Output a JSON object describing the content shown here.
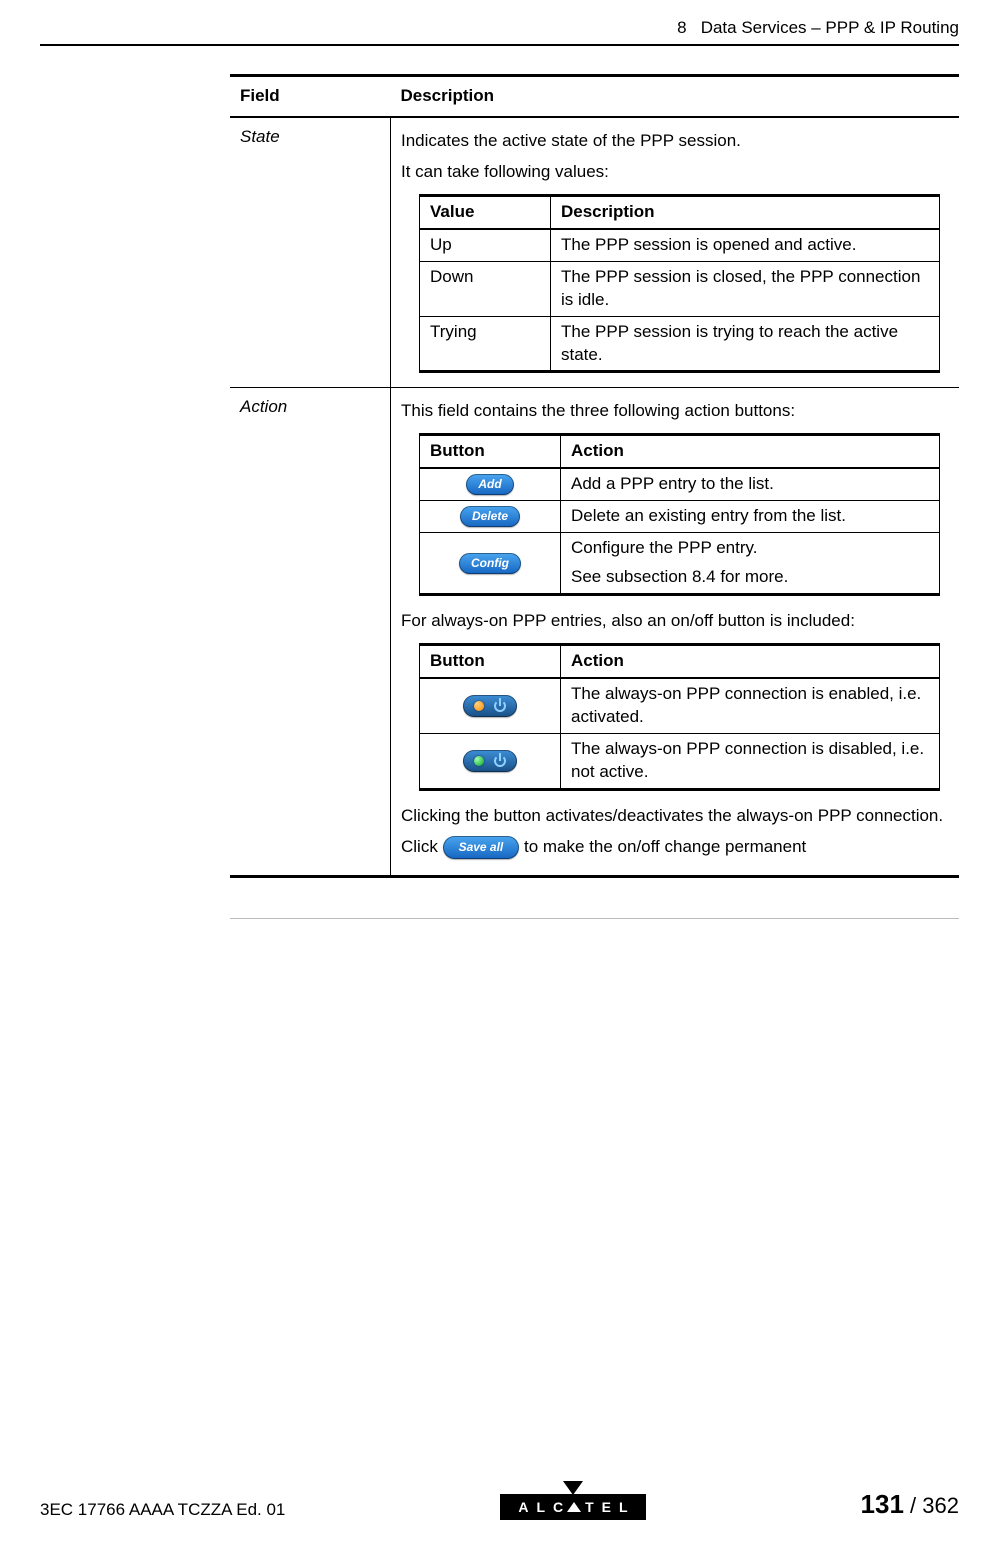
{
  "header": {
    "chapter_num": "8",
    "chapter_title": "Data Services – PPP & IP Routing"
  },
  "main_table": {
    "headers": {
      "field": "Field",
      "description": "Description"
    },
    "rows": {
      "state": {
        "field": "State",
        "p1": "Indicates the active state of the PPP session.",
        "p2": "It can take following values:",
        "values_table": {
          "headers": {
            "value": "Value",
            "description": "Description"
          },
          "rows": [
            {
              "value": "Up",
              "desc": "The PPP session is opened and active."
            },
            {
              "value": "Down",
              "desc": "The PPP session is closed, the PPP connection is idle."
            },
            {
              "value": "Trying",
              "desc": "The PPP session is trying to reach the active state."
            }
          ]
        }
      },
      "action": {
        "field": "Action",
        "p1": "This field contains the three following action buttons:",
        "buttons_table": {
          "headers": {
            "button": "Button",
            "action": "Action"
          },
          "rows": [
            {
              "btn": "Add",
              "desc": "Add a PPP entry to the list."
            },
            {
              "btn": "Delete",
              "desc": "Delete an existing entry from the list."
            },
            {
              "btn": "Config",
              "desc1": "Configure the PPP entry.",
              "desc2": "See subsection 8.4 for more."
            }
          ]
        },
        "p2": "For always-on PPP entries, also an on/off button is included:",
        "onoff_table": {
          "headers": {
            "button": "Button",
            "action": "Action"
          },
          "rows": [
            {
              "state": "on",
              "desc": "The always-on PPP connection is enabled, i.e. activated."
            },
            {
              "state": "off",
              "desc": "The always-on PPP connection is disabled, i.e. not active."
            }
          ]
        },
        "p3": "Clicking the button activates/deactivates the always-on PPP connection.",
        "p4_pre": "Click ",
        "saveall_btn": "Save all",
        "p4_post": " to make the on/off change permanent"
      }
    }
  },
  "footer": {
    "doc_ref": "3EC 17766 AAAA TCZZA Ed. 01",
    "logo_left": "ALC",
    "logo_right": "TEL",
    "page_current": "131",
    "page_sep": " / ",
    "page_total": "362"
  }
}
